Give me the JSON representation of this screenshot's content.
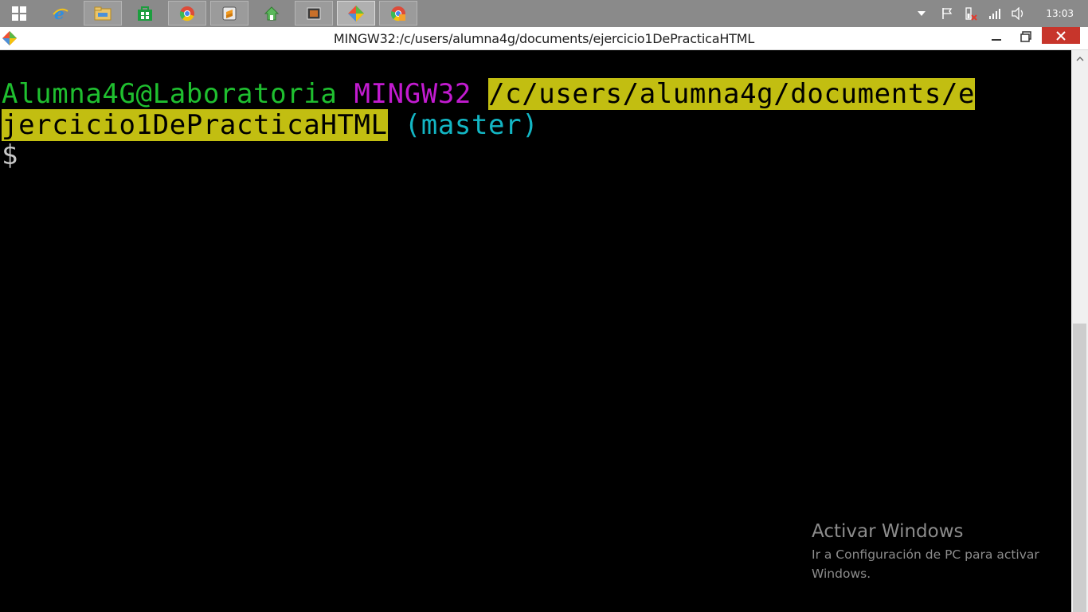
{
  "taskbar": {
    "items": [
      {
        "icon": "windows-start-icon"
      },
      {
        "icon": "internet-explorer-icon"
      },
      {
        "icon": "file-explorer-icon"
      },
      {
        "icon": "windows-store-icon"
      },
      {
        "icon": "chrome-icon"
      },
      {
        "icon": "sublime-text-icon"
      },
      {
        "icon": "home-app-icon"
      },
      {
        "icon": "slideshow-app-icon"
      },
      {
        "icon": "git-bash-icon",
        "active": true
      },
      {
        "icon": "chrome-canary-icon"
      }
    ],
    "tray": [
      "chevron-up-icon",
      "action-center-flag-icon",
      "power-plug-icon",
      "network-signal-icon",
      "volume-icon"
    ],
    "clock": "13:03"
  },
  "window": {
    "title": "MINGW32:/c/users/alumna4g/documents/ejercicio1DePracticaHTML",
    "controls": [
      "minimize-icon",
      "maximize-icon",
      "close-icon"
    ]
  },
  "terminal": {
    "user_host": "Alumna4G@Laboratoria",
    "system": "MINGW32",
    "path_line1": "/c/users/alumna4g/documents/e",
    "path_line2": "jercicio1DePracticaHTML",
    "branch": "(master)",
    "prompt": "$"
  },
  "watermark": {
    "title": "Activar Windows",
    "subtitle": "Ir a Configuración de PC para activar Windows."
  },
  "colors": {
    "user_host": "#1fbf2f",
    "system": "#c21bd0",
    "path_bg": "#c2be11",
    "branch": "#13b6c4",
    "close_button": "#c7352b",
    "taskbar": "#8a8a8a"
  }
}
